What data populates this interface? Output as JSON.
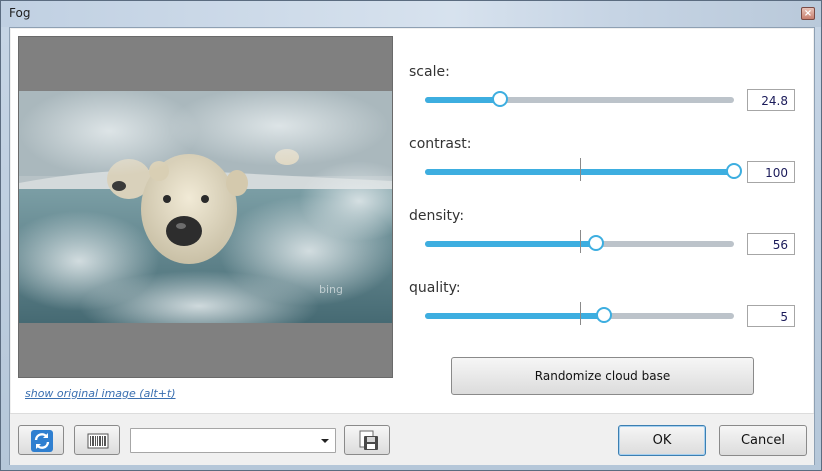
{
  "window": {
    "title": "Fog",
    "close_symbol": "×"
  },
  "preview": {
    "show_original_link": "show original image (alt+t)",
    "watermark": "bing"
  },
  "sliders": [
    {
      "label": "scale:",
      "value": "24.8",
      "fill_fraction": 0.244,
      "tick_fraction": null
    },
    {
      "label": "contrast:",
      "value": "100",
      "fill_fraction": 1.0,
      "tick_fraction": 0.5
    },
    {
      "label": "density:",
      "value": "56",
      "fill_fraction": 0.553,
      "tick_fraction": 0.5
    },
    {
      "label": "quality:",
      "value": "5",
      "fill_fraction": 0.579,
      "tick_fraction": 0.5
    }
  ],
  "randomize_button": "Randomize cloud base",
  "toolbar": {
    "preset_value": "",
    "ok_label": "OK",
    "cancel_label": "Cancel",
    "icons": [
      "refresh-icon",
      "barcode-icon",
      "save-icon"
    ]
  },
  "colors": {
    "accent": "#3daee0",
    "track": "#bcc3ca"
  }
}
